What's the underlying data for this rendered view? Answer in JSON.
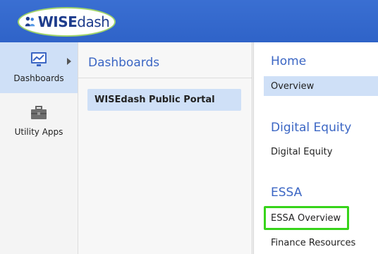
{
  "logo": {
    "wise": "WISE",
    "dash": "dash"
  },
  "iconbar": {
    "items": [
      {
        "label": "Dashboards",
        "icon": "chart-icon",
        "active": true
      },
      {
        "label": "Utility Apps",
        "icon": "toolbox-icon",
        "active": false
      }
    ]
  },
  "dashboards_panel": {
    "title": "Dashboards",
    "items": [
      {
        "label": "WISEdash Public Portal",
        "selected": true
      }
    ]
  },
  "nav_panel": {
    "sections": [
      {
        "title": "Home",
        "links": [
          {
            "label": "Overview",
            "selected": true
          }
        ]
      },
      {
        "title": "Digital Equity",
        "links": [
          {
            "label": "Digital Equity"
          }
        ]
      },
      {
        "title": "ESSA",
        "links": [
          {
            "label": "ESSA Overview",
            "highlighted": true
          },
          {
            "label": "Finance Resources"
          }
        ]
      }
    ]
  },
  "colors": {
    "header": "#2f63c8",
    "accent_text": "#3b66c4",
    "selected_bg": "#cfe0f7",
    "highlight": "#37d41a"
  }
}
